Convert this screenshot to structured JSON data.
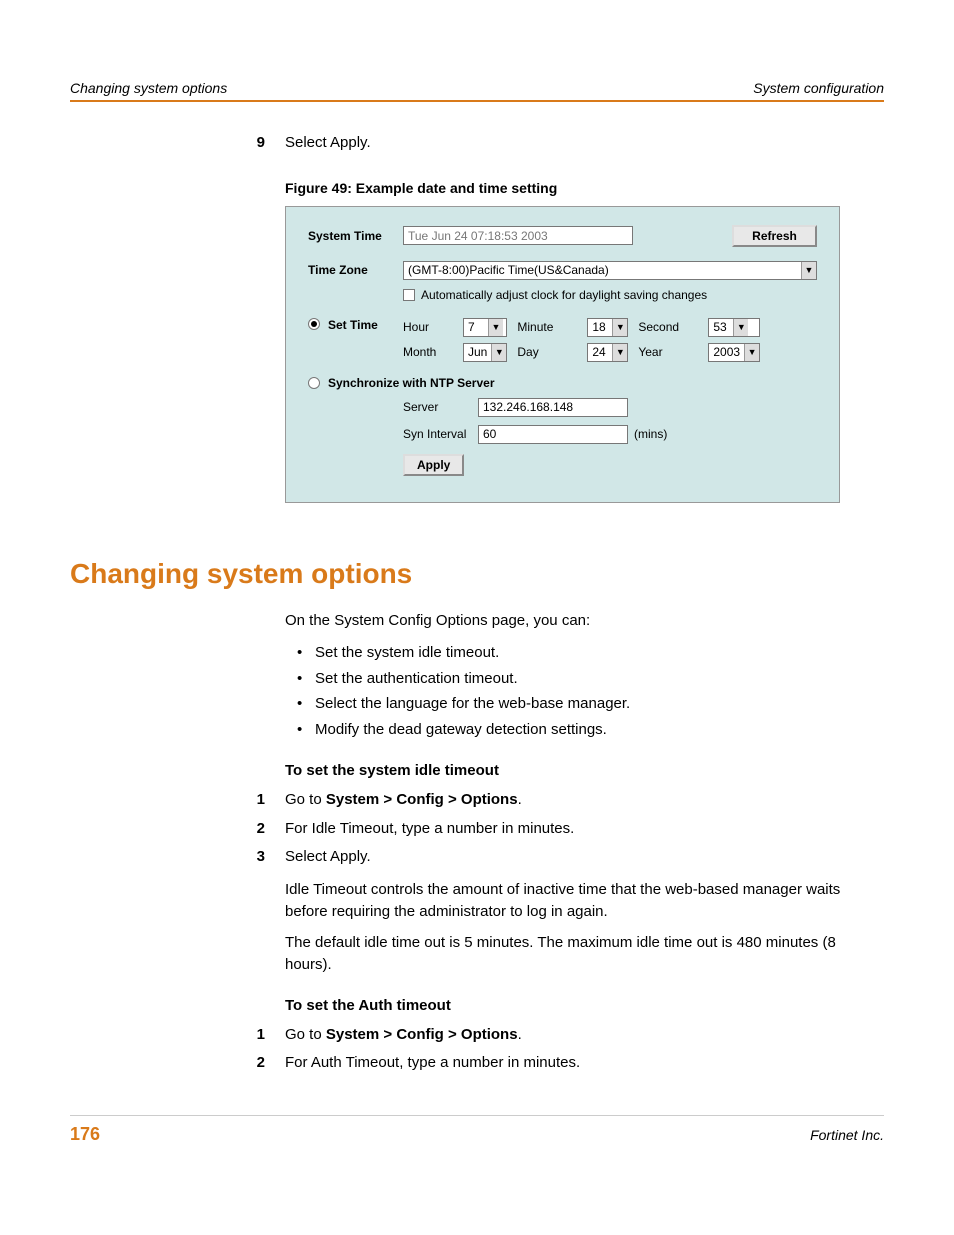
{
  "header": {
    "left": "Changing system options",
    "right": "System configuration"
  },
  "step9": {
    "num": "9",
    "text": "Select Apply."
  },
  "figure": {
    "caption": "Figure 49: Example date and time setting"
  },
  "screenshot": {
    "system_time_label": "System Time",
    "system_time_value": "Tue Jun 24 07:18:53 2003",
    "refresh_btn": "Refresh",
    "time_zone_label": "Time Zone",
    "time_zone_value": "(GMT-8:00)Pacific Time(US&Canada)",
    "dst_label": "Automatically adjust clock for daylight saving changes",
    "set_time_label": "Set Time",
    "hour_label": "Hour",
    "hour_value": "7",
    "minute_label": "Minute",
    "minute_value": "18",
    "second_label": "Second",
    "second_value": "53",
    "month_label": "Month",
    "month_value": "Jun",
    "day_label": "Day",
    "day_value": "24",
    "year_label": "Year",
    "year_value": "2003",
    "ntp_label": "Synchronize with NTP Server",
    "server_label": "Server",
    "server_value": "132.246.168.148",
    "syn_interval_label": "Syn Interval",
    "syn_interval_value": "60",
    "mins_label": "(mins)",
    "apply_btn": "Apply"
  },
  "section": {
    "heading": "Changing system options",
    "intro": "On the System Config Options page, you can:",
    "bullets": [
      "Set the system idle timeout.",
      "Set the authentication timeout.",
      "Select the language for the web-base manager.",
      "Modify the dead gateway detection settings."
    ],
    "idle_heading": "To set the system idle timeout",
    "idle_steps": [
      {
        "num": "1",
        "pre": "Go to ",
        "bold": "System > Config > Options",
        "post": "."
      },
      {
        "num": "2",
        "pre": "For Idle Timeout, type a number in minutes.",
        "bold": "",
        "post": ""
      },
      {
        "num": "3",
        "pre": "Select Apply.",
        "bold": "",
        "post": ""
      }
    ],
    "idle_para1": "Idle Timeout controls the amount of inactive time that the web-based manager waits before requiring the administrator to log in again.",
    "idle_para2": "The default idle time out is 5 minutes. The maximum idle time out is 480 minutes (8 hours).",
    "auth_heading": "To set the Auth timeout",
    "auth_steps": [
      {
        "num": "1",
        "pre": "Go to ",
        "bold": "System > Config > Options",
        "post": "."
      },
      {
        "num": "2",
        "pre": "For Auth Timeout, type a number in minutes.",
        "bold": "",
        "post": ""
      }
    ]
  },
  "footer": {
    "page_num": "176",
    "company": "Fortinet Inc."
  }
}
